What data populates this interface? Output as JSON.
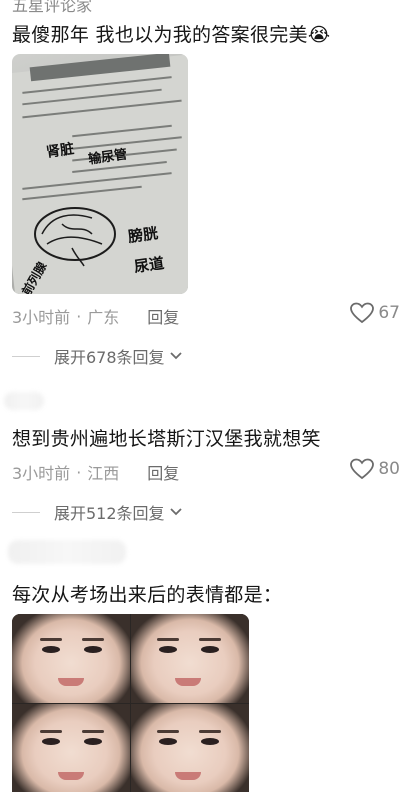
{
  "header": {
    "top_label": "五星评论家"
  },
  "comments": [
    {
      "text": "最傻那年 我也以为我的答案很完美😭",
      "time": "3小时前",
      "location": "广东",
      "reply_label": "回复",
      "likes": "67",
      "expand_label": "展开678条回复"
    },
    {
      "text": "想到贵州遍地长塔斯汀汉堡我就想笑",
      "time": "3小时前",
      "location": "江西",
      "reply_label": "回复",
      "likes": "80",
      "expand_label": "展开512条回复"
    },
    {
      "text": "每次从考场出来后的表情都是："
    }
  ],
  "image1_handwriting": [
    "肾脏",
    "输尿管",
    "膀胱",
    "尿道",
    "前列腺"
  ],
  "colors": {
    "meta": "#9a9a9a",
    "text": "#161616",
    "accent": "#6b6b6b"
  },
  "icons": {
    "like": "heart-outline-icon",
    "expand": "chevron-down-icon"
  }
}
